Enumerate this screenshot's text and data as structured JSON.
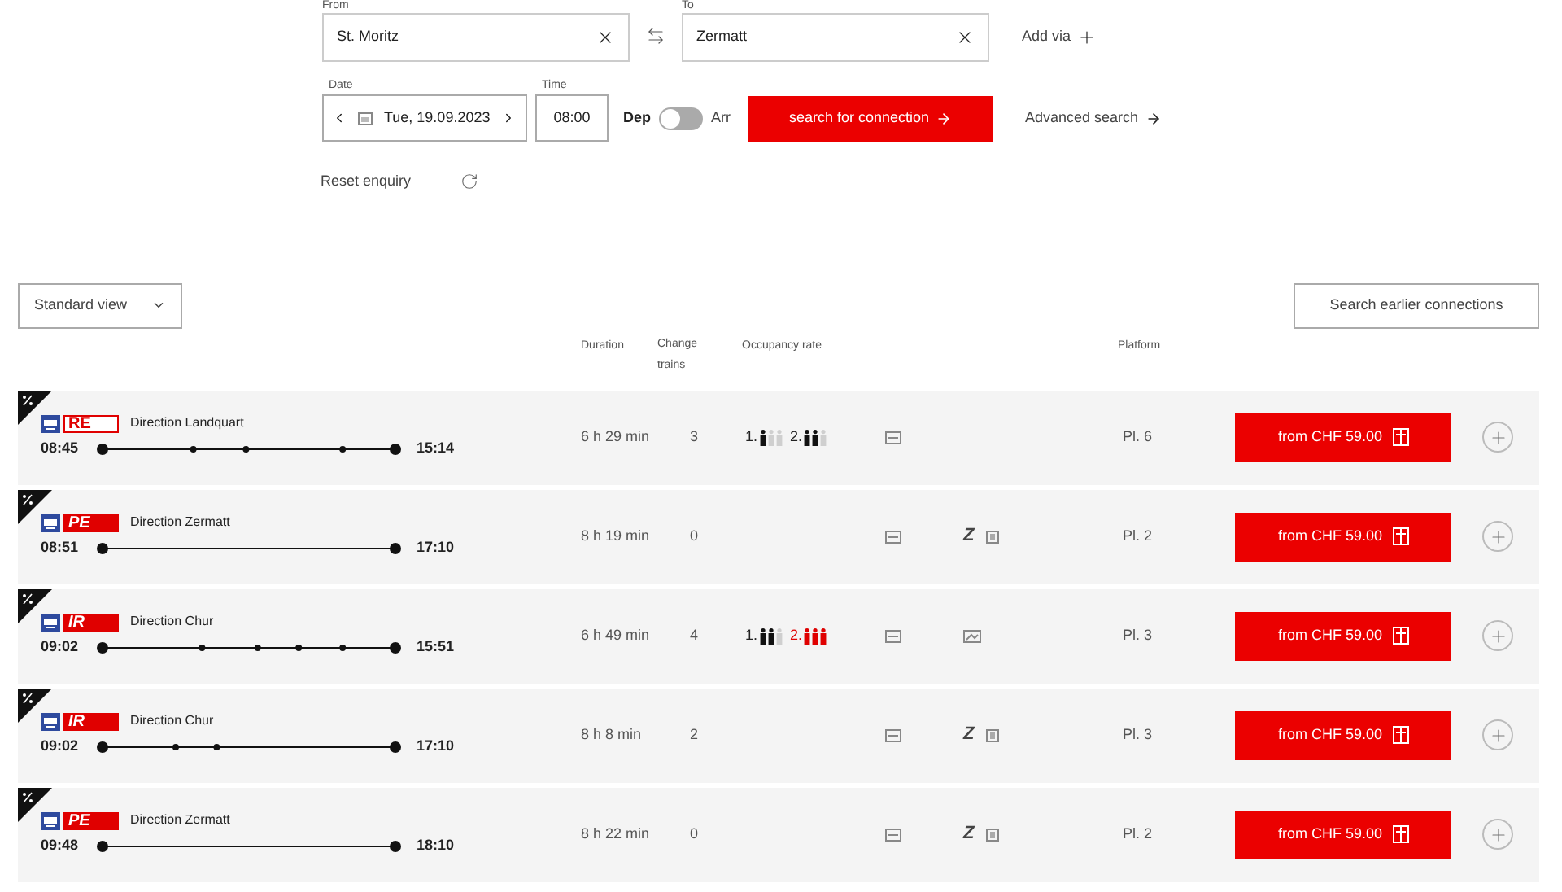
{
  "search": {
    "from": {
      "label": "From",
      "value": "St. Moritz"
    },
    "to": {
      "label": "To",
      "value": "Zermatt"
    },
    "add_via": "Add via",
    "date": {
      "label": "Date",
      "value": "Tue, 19.09.2023"
    },
    "time": {
      "label": "Time",
      "value": "08:00"
    },
    "dep_label": "Dep",
    "arr_label": "Arr",
    "arrival": false,
    "submit": "search for connection",
    "advanced": "Advanced search",
    "reset": "Reset enquiry"
  },
  "view_select": "Standard view",
  "earlier_button": "Search earlier connections",
  "columns": {
    "duration": "Duration",
    "change": [
      "Change",
      "trains"
    ],
    "occupancy": "Occupancy rate",
    "platform": "Platform"
  },
  "connections": [
    {
      "badge": "RE",
      "badge_outlined": true,
      "direction": "Direction Landquart",
      "depart": "08:45",
      "arrive": "15:14",
      "stops": [
        {
          "level": 0.31
        },
        {
          "level": 0.49
        },
        {
          "level": 0.82
        }
      ],
      "duration": "6 h 29 min",
      "changes": "3",
      "occupancy": [
        {
          "label": "1.",
          "level": 0.33
        },
        {
          "label": "2.",
          "level": 0.67
        }
      ],
      "features": [
        {
          "kind": "card"
        }
      ],
      "platform": "Pl. 6",
      "price": "from CHF 59.00"
    },
    {
      "badge": "PE",
      "badge_outlined": false,
      "direction": "Direction Zermatt",
      "depart": "08:51",
      "arrive": "17:10",
      "duration": "8 h 19 min",
      "changes": "0",
      "features": [
        {
          "kind": "card"
        },
        {
          "kind": "letter",
          "text": "Z"
        },
        {
          "kind": "box"
        }
      ],
      "platform": "Pl. 2",
      "price": "from CHF 59.00"
    },
    {
      "badge": "IR",
      "badge_outlined": false,
      "direction": "Direction Chur",
      "depart": "09:02",
      "arrive": "15:51",
      "stops": [
        {
          "level": 0.34
        },
        {
          "level": 0.53
        },
        {
          "level": 0.67
        },
        {
          "level": 0.82
        }
      ],
      "duration": "6 h 49 min",
      "changes": "4",
      "occupancy": [
        {
          "label": "1.",
          "level": 0.67
        },
        {
          "label": "2.",
          "level": 1
        }
      ],
      "features": [
        {
          "kind": "card"
        },
        {
          "kind": "screen"
        }
      ],
      "platform": "Pl. 3",
      "price": "from CHF 59.00"
    },
    {
      "badge": "IR",
      "badge_outlined": false,
      "direction": "Direction Chur",
      "depart": "09:02",
      "arrive": "17:10",
      "stops": [
        {
          "level": 0.25
        },
        {
          "level": 0.39
        }
      ],
      "duration": "8 h 8 min",
      "changes": "2",
      "features": [
        {
          "kind": "card"
        },
        {
          "kind": "letter",
          "text": "Z"
        },
        {
          "kind": "box"
        }
      ],
      "platform": "Pl. 3",
      "price": "from CHF 59.00"
    },
    {
      "badge": "PE",
      "badge_outlined": false,
      "direction": "Direction Zermatt",
      "depart": "09:48",
      "arrive": "18:10",
      "duration": "8 h 22 min",
      "changes": "0",
      "features": [
        {
          "kind": "card"
        },
        {
          "kind": "letter",
          "text": "Z"
        },
        {
          "kind": "box"
        }
      ],
      "platform": "Pl. 2",
      "price": "from CHF 59.00"
    }
  ]
}
